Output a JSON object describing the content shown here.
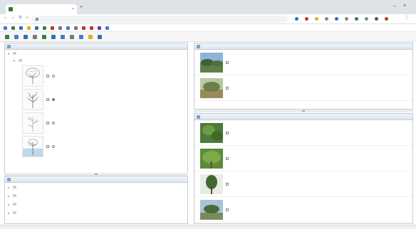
{
  "browser": {
    "tab_title": "",
    "url": "",
    "bookmarks": [
      {
        "label": "",
        "color": "#4a7ac8"
      },
      {
        "label": "",
        "color": "#3a7f3a"
      },
      {
        "label": "",
        "color": "#2f6fb5"
      },
      {
        "label": "",
        "color": "#e0b020"
      },
      {
        "label": "",
        "color": "#2f6fb5"
      },
      {
        "label": "",
        "color": "#3a7f3a"
      },
      {
        "label": "",
        "color": "#c0392b"
      },
      {
        "label": "",
        "color": "#7a7a7a"
      },
      {
        "label": "",
        "color": "#4a7ac8"
      },
      {
        "label": "",
        "color": "#7a7a7a"
      },
      {
        "label": "",
        "color": "#c0392b"
      },
      {
        "label": "",
        "color": "#c0392b"
      },
      {
        "label": "",
        "color": "#6a3ab5"
      },
      {
        "label": "",
        "color": "#4a7ac8"
      }
    ]
  },
  "features_available": {
    "title": "",
    "tree": [
      {
        "label": ""
      },
      {
        "label": ""
      }
    ],
    "states": [
      {
        "label": "",
        "selected": false
      },
      {
        "label": "",
        "selected": true
      },
      {
        "label": "",
        "selected": false
      },
      {
        "label": "",
        "selected": false
      }
    ]
  },
  "features_chosen": {
    "title": "",
    "items": [
      {
        "label": ""
      },
      {
        "label": ""
      },
      {
        "label": ""
      },
      {
        "label": ""
      }
    ]
  },
  "entities_remaining": {
    "title": "",
    "items": [
      {
        "label": "",
        "selected": true
      },
      {
        "label": "",
        "selected": false
      }
    ]
  },
  "entities_discarded": {
    "title": "",
    "items": [
      {
        "label": ""
      },
      {
        "label": ""
      },
      {
        "label": ""
      },
      {
        "label": ""
      }
    ]
  },
  "colors": {
    "panel_header_text": "#1f3f6a",
    "selection": "#cfe0f5",
    "accent": "#2e7d32"
  }
}
